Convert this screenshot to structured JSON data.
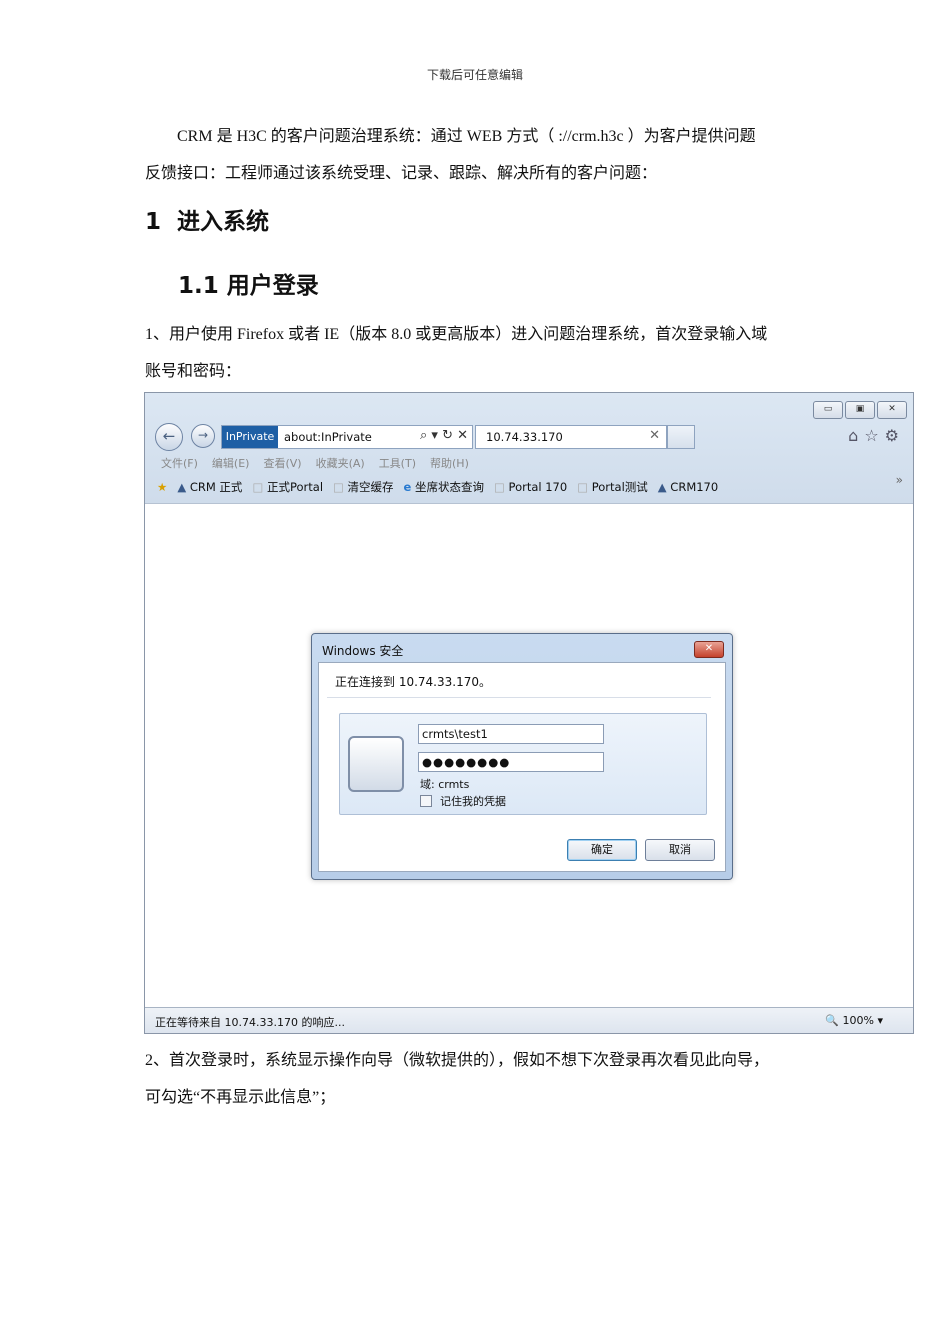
{
  "header_note": "下载后可任意编辑",
  "intro": {
    "line1": "CRM 是 H3C 的客户问题治理系统：通过 WEB 方式（     ://crm.h3c     ）为客户提供问题",
    "line2": "反馈接口：工程师通过该系统受理、记录、跟踪、解决所有的客户问题："
  },
  "section1": {
    "num": "1",
    "title": "进入系统"
  },
  "section11": {
    "title": "1.1 用户登录"
  },
  "step1": {
    "line1": "1、用户使用 Firefox 或者 IE（版本 8.0 或更高版本）进入问题治理系统，首次登录输入域",
    "line2": "账号和密码："
  },
  "browser": {
    "win_buttons": [
      "▭",
      "▣",
      "✕"
    ],
    "inprivate_label": "InPrivate",
    "address": "about:InPrivate",
    "address_controls": "⌕ ▾ ↻ ✕",
    "tab_title": "10.74.33.170",
    "tab_close": "✕",
    "right_icons": "⌂☆⚙",
    "menu": [
      "文件(F)",
      "编辑(E)",
      "查看(V)",
      "收藏夹(A)",
      "工具(T)",
      "帮助(H)"
    ],
    "favorites": [
      "CRM 正式",
      "正式Portal",
      "清空缓存",
      "坐席状态查询",
      "Portal 170",
      "Portal测试",
      "CRM170"
    ],
    "chevron": "»",
    "status_text": "正在等待来自 10.74.33.170 的响应...",
    "zoom": "100%"
  },
  "dialog": {
    "title": "Windows 安全",
    "close": "✕",
    "connecting": "正在连接到 10.74.33.170。",
    "username": "crmts\\test1",
    "password": "●●●●●●●●",
    "domain": "域: crmts",
    "remember": "记住我的凭据",
    "ok": "确定",
    "cancel": "取消"
  },
  "step2": {
    "line1": "2、首次登录时，系统显示操作向导（微软提供的），假如不想下次登录再次看见此向导，",
    "line2": "可勾选“不再显示此信息”；"
  }
}
